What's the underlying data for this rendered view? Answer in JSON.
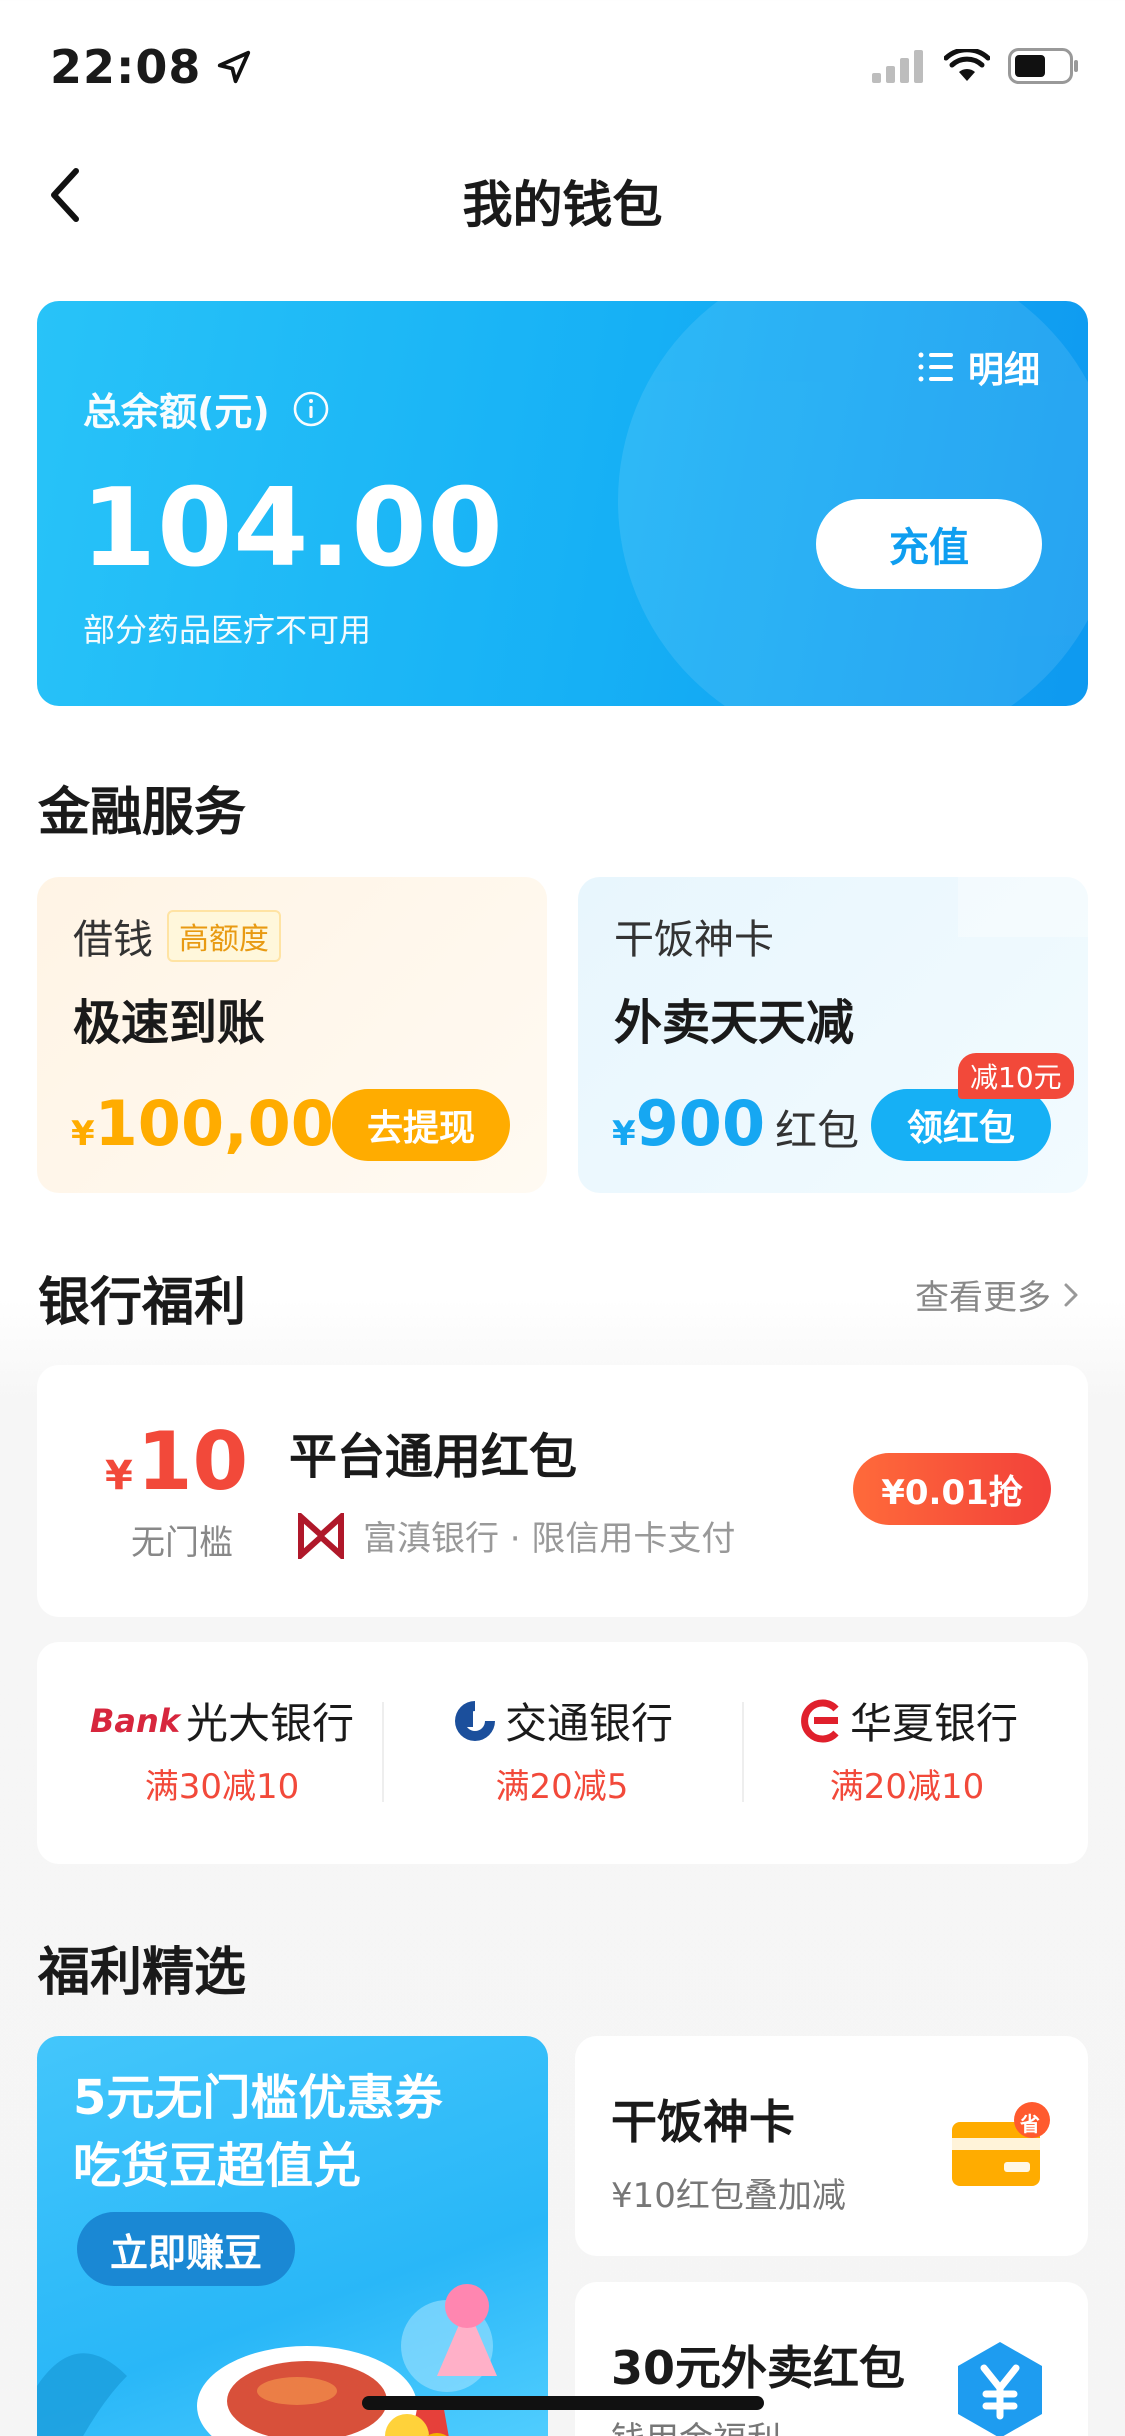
{
  "status_bar": {
    "time": "22:08"
  },
  "nav": {
    "title": "我的钱包"
  },
  "balance": {
    "detail_label": "明细",
    "label": "总余额(元)",
    "amount": "104.00",
    "note": "部分药品医疗不可用",
    "recharge_label": "充值"
  },
  "finance": {
    "title": "金融服务",
    "loan": {
      "name": "借钱",
      "tag": "高额度",
      "headline": "极速到账",
      "currency": "¥",
      "amount": "100,000",
      "button": "去提现"
    },
    "card": {
      "name": "干饭神卡",
      "headline": "外卖天天减",
      "currency": "¥",
      "amount": "900",
      "unit": "红包",
      "badge": "减10元",
      "button": "领红包"
    }
  },
  "bank_benefits": {
    "title": "银行福利",
    "more": "查看更多",
    "coupon": {
      "currency": "¥",
      "amount": "10",
      "threshold": "无门槛",
      "title": "平台通用红包",
      "bank_text": "富滇银行 · 限信用卡支付",
      "button": "¥0.01抢"
    },
    "banks": [
      {
        "logo": "Bank",
        "name": "光大银行",
        "offer": "满30减10"
      },
      {
        "name": "交通银行",
        "offer": "满20减5"
      },
      {
        "name": "华夏银行",
        "offer": "满20减10"
      }
    ]
  },
  "featured": {
    "title": "福利精选",
    "promo": {
      "line1": "5元无门槛优惠券",
      "line2": "吃货豆超值兑",
      "button": "立即赚豆"
    },
    "items": [
      {
        "title": "干饭神卡",
        "subtitle": "¥10红包叠加减",
        "badge": "省"
      },
      {
        "title": "30元外卖红包",
        "subtitle": "钱用金福利"
      }
    ]
  },
  "colors": {
    "accent_blue": "#16b0f5",
    "orange": "#ffac00",
    "red": "#f2493a"
  }
}
